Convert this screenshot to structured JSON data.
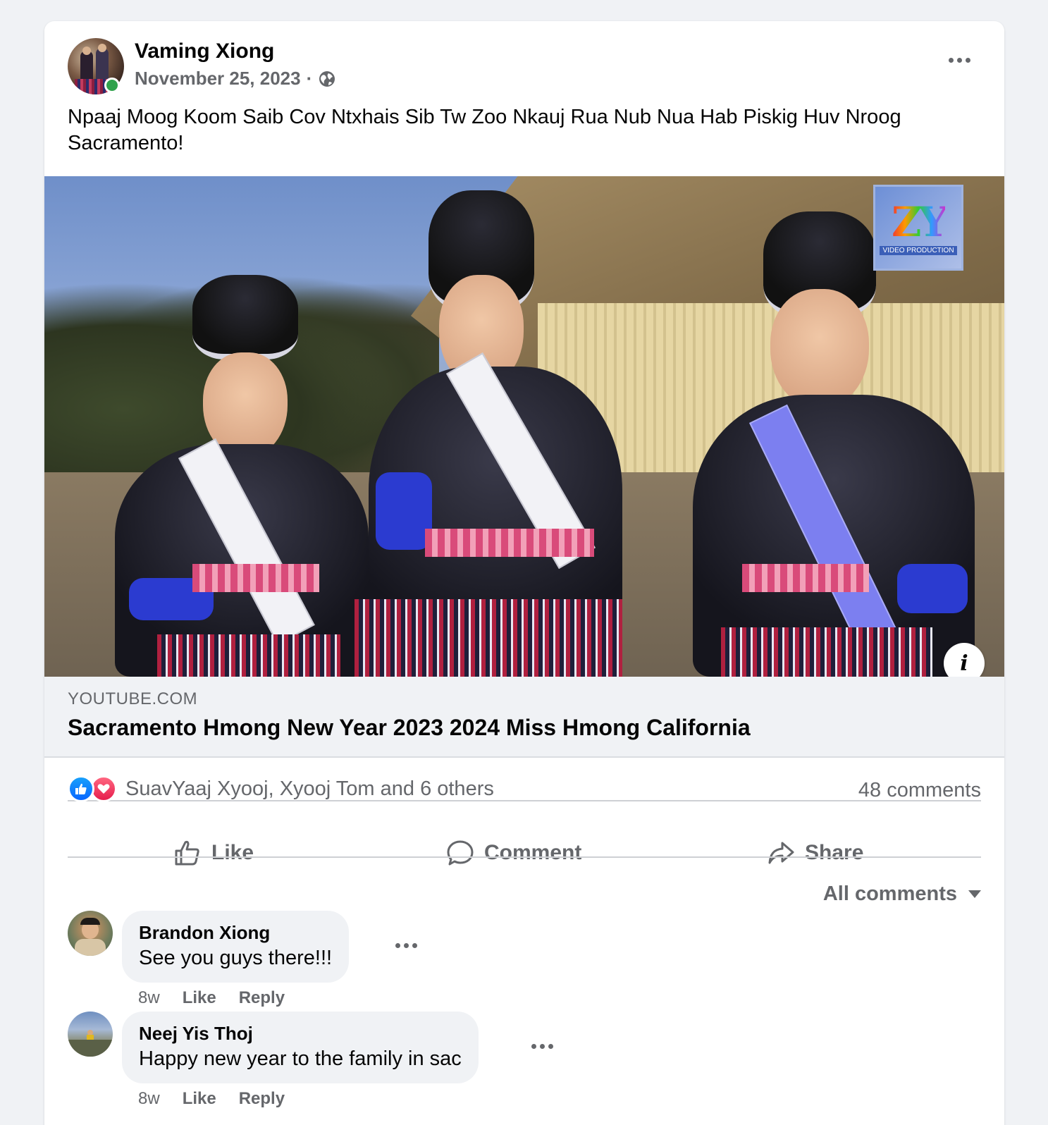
{
  "post": {
    "author": "Vaming Xiong",
    "date": "November 25, 2023",
    "separator": "·",
    "text": "Npaaj Moog Koom Saib Cov Ntxhais Sib Tw Zoo Nkauj Rua Nub Nua Hab Piskig Huv Nroog Sacramento!",
    "audience_icon": "globe-icon",
    "online_status": "online"
  },
  "media": {
    "watermark_text": "ZY",
    "watermark_subtext": "VIDEO PRODUCTION",
    "info_icon": "info-icon"
  },
  "link_preview": {
    "domain": "YOUTUBE.COM",
    "title": "Sacramento Hmong New Year 2023 2024 Miss Hmong California"
  },
  "reactions": {
    "types": [
      "like",
      "love"
    ],
    "names": "SuavYaaj Xyooj, Xyooj Tom and 6 others",
    "comments_count": "48 comments"
  },
  "actions": {
    "like": "Like",
    "comment": "Comment",
    "share": "Share"
  },
  "comments_filter": "All comments",
  "comments": [
    {
      "name": "Brandon Xiong",
      "text": "See you guys there!!!",
      "time": "8w",
      "like": "Like",
      "reply": "Reply"
    },
    {
      "name": "Neej Yis Thoj",
      "text": "Happy new year to the family in sac",
      "time": "8w",
      "like": "Like",
      "reply": "Reply"
    }
  ],
  "colors": {
    "background": "#f0f2f5",
    "card": "#ffffff",
    "secondary_text": "#65676b",
    "primary_text": "#050505",
    "like_blue": "#0866ff",
    "love_red": "#e61e4d",
    "online_green": "#31a24c"
  }
}
